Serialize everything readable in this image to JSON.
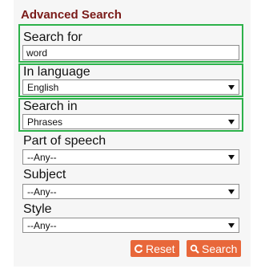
{
  "title": "Advanced Search",
  "search_for": {
    "label": "Search for",
    "value": "word"
  },
  "in_language": {
    "label": "In language",
    "selected": "English"
  },
  "search_in": {
    "label": "Search in",
    "selected": "Phrases"
  },
  "part_of_speech": {
    "label": "Part of speech",
    "selected": "--Any--"
  },
  "subject": {
    "label": "Subject",
    "selected": "--Any--"
  },
  "style": {
    "label": "Style",
    "selected": "--Any--"
  },
  "buttons": {
    "reset_label": "Reset",
    "search_label": "Search"
  },
  "icons": {
    "reset": "refresh-icon",
    "search": "search-icon"
  },
  "colors": {
    "title": "#7a1a18",
    "highlight_border": "#2db24a",
    "button": "#e8673a",
    "panel": "#f6f6f6"
  }
}
